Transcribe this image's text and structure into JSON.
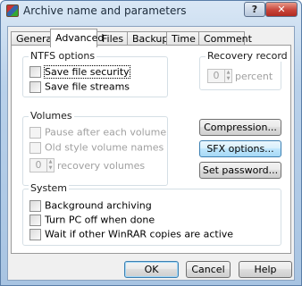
{
  "window": {
    "title": "Archive name and parameters",
    "help_label": "?",
    "close_label": "✕"
  },
  "tabs": [
    {
      "label": "General"
    },
    {
      "label": "Advanced",
      "active": true
    },
    {
      "label": "Files"
    },
    {
      "label": "Backup"
    },
    {
      "label": "Time"
    },
    {
      "label": "Comment"
    }
  ],
  "ntfs": {
    "title": "NTFS options",
    "save_security": {
      "label": "Save file security",
      "checked": false
    },
    "save_streams": {
      "label": "Save file streams",
      "checked": false
    }
  },
  "recovery": {
    "title": "Recovery record",
    "value": "0",
    "unit": "percent"
  },
  "volumes": {
    "title": "Volumes",
    "pause": {
      "label": "Pause after each volume",
      "checked": false
    },
    "old_style": {
      "label": "Old style volume names",
      "checked": false
    },
    "recovery_volumes_value": "0",
    "recovery_volumes_label": "recovery volumes"
  },
  "buttons": {
    "compression": "Compression...",
    "sfx": "SFX options...",
    "password": "Set password...",
    "ok": "OK",
    "cancel": "Cancel",
    "help": "Help"
  },
  "system": {
    "title": "System",
    "background": {
      "label": "Background archiving",
      "checked": false
    },
    "turn_off": {
      "label": "Turn PC off when done",
      "checked": false
    },
    "wait": {
      "label": "Wait if other WinRAR copies are active",
      "checked": false
    }
  },
  "colors": {
    "title_bar": "#b9d1ea",
    "close_button": "#c8443a",
    "hover_button": "#bee6fd",
    "disabled_text": "#a0a0a0"
  }
}
